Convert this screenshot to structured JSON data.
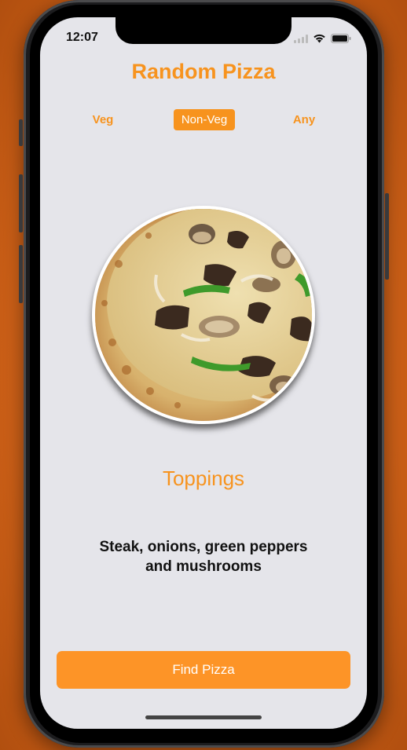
{
  "status_bar": {
    "time": "12:07"
  },
  "app": {
    "title": "Random Pizza"
  },
  "filter": {
    "options": [
      "Veg",
      "Non-Veg",
      "Any"
    ],
    "selected": "Non-Veg"
  },
  "toppings": {
    "heading": "Toppings",
    "line1": "Steak, onions, green peppers",
    "line2": "and mushrooms"
  },
  "actions": {
    "find_label": "Find Pizza"
  },
  "colors": {
    "accent": "#f7931e",
    "button": "#fd9427",
    "screen_bg": "#e5e5ea",
    "background": "#d5651a"
  },
  "icons": {
    "signal": "cellular-signal-icon",
    "wifi": "wifi-icon",
    "battery": "battery-icon"
  }
}
